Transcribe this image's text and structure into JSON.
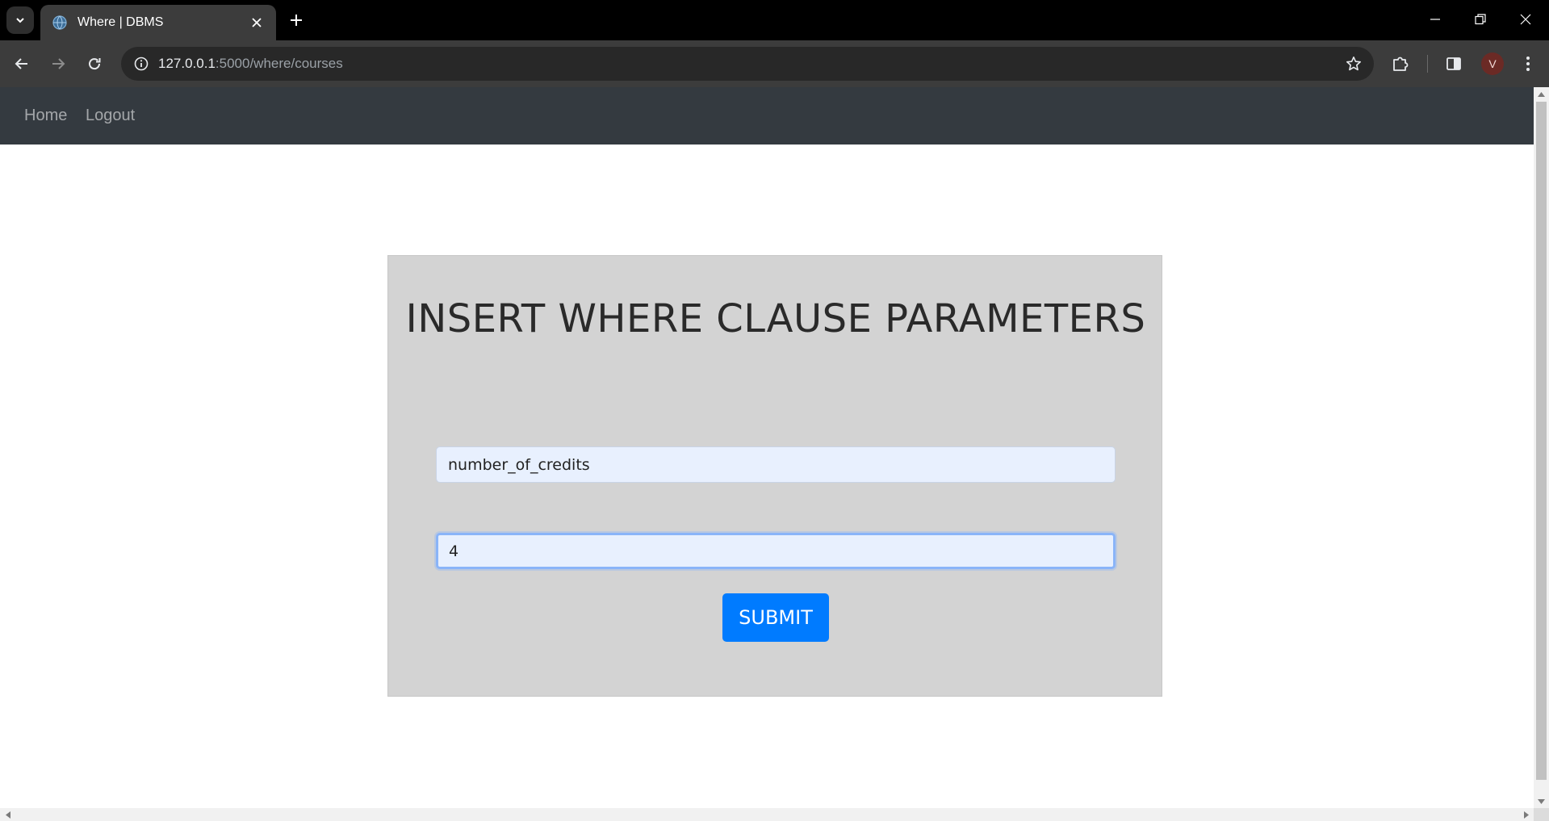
{
  "browser": {
    "tab_title": "Where | DBMS",
    "url_host": "127.0.0.1",
    "url_rest": ":5000/where/courses",
    "profile_initial": "V",
    "icons": {
      "tab_search": "chevron-down-icon",
      "favicon": "globe-icon",
      "tab_close": "close-icon",
      "new_tab": "plus-icon",
      "back": "arrow-left-icon",
      "forward": "arrow-right-icon",
      "reload": "reload-icon",
      "site_info": "info-icon",
      "bookmark": "star-icon",
      "extensions": "puzzle-icon",
      "side_panel": "side-panel-icon",
      "menu": "kebab-menu-icon"
    }
  },
  "navbar": {
    "home_label": "Home",
    "logout_label": "Logout"
  },
  "form": {
    "title": "INSERT WHERE CLAUSE PARAMETERS",
    "column_value": "number_of_credits",
    "value_value": "4",
    "submit_label": "SUBMIT"
  },
  "colors": {
    "navbar_bg": "#343a40",
    "card_bg": "#d3d3d3",
    "input_bg": "#e8f0fe",
    "submit_bg": "#007bff",
    "focus_ring": "#8ab4f8"
  }
}
